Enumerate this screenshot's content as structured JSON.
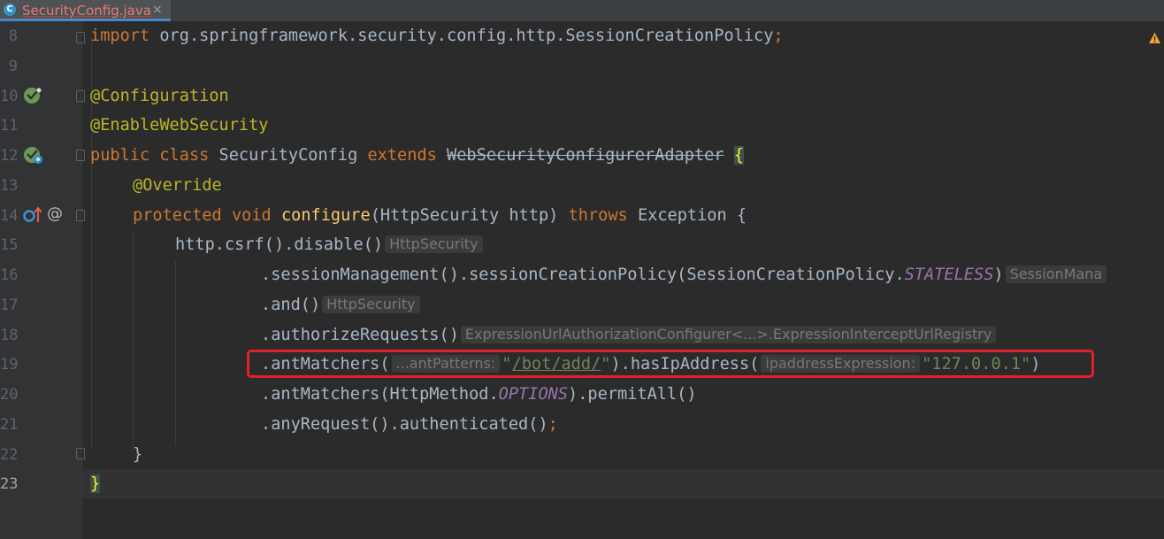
{
  "tab": {
    "icon": "C",
    "file_name": "SecurityConfig.java",
    "close": "×"
  },
  "gutter": {
    "warning_icon": "warning-icon",
    "bean_icon": "spring-bean-icon",
    "override_icon": "override-up-arrow-icon",
    "at_icon": "@"
  },
  "lines": [
    {
      "num": "8",
      "text": "import org.springframework.security.config.http.SessionCreationPolicy;"
    },
    {
      "num": "9",
      "text": ""
    },
    {
      "num": "10",
      "text": "@Configuration"
    },
    {
      "num": "11",
      "text": "@EnableWebSecurity"
    },
    {
      "num": "12",
      "text": "public class SecurityConfig extends WebSecurityConfigurerAdapter {"
    },
    {
      "num": "13",
      "text": "@Override"
    },
    {
      "num": "14",
      "text": "protected void configure(HttpSecurity http) throws Exception {"
    },
    {
      "num": "15",
      "text": "http.csrf().disable()"
    },
    {
      "num": "16",
      "text": ".sessionManagement().sessionCreationPolicy(SessionCreationPolicy.STATELESS)"
    },
    {
      "num": "17",
      "text": ".and()"
    },
    {
      "num": "18",
      "text": ".authorizeRequests()"
    },
    {
      "num": "19",
      "text": ".antMatchers(\"/bot/add/\").hasIpAddress(\"127.0.0.1\")"
    },
    {
      "num": "20",
      "text": ".antMatchers(HttpMethod.OPTIONS).permitAll()"
    },
    {
      "num": "21",
      "text": ".anyRequest().authenticated();"
    },
    {
      "num": "22",
      "text": "}"
    },
    {
      "num": "23",
      "text": "}"
    }
  ],
  "tokens": {
    "import_kw": "import",
    "import_path": " org.springframework.security.config.http.SessionCreationPolicy",
    "semicolon": ";",
    "ann_configuration": "@Configuration",
    "ann_enablewebsecurity": "@EnableWebSecurity",
    "public_class": "public class",
    "class_name": " SecurityConfig ",
    "extends_kw": "extends",
    "space": " ",
    "parent_class": "WebSecurityConfigurerAdapter",
    "open_brace": "{",
    "close_brace": "}",
    "ann_override": "@Override",
    "protected_void": "protected void",
    "configure_method": "configure",
    "params": "(HttpSecurity http) ",
    "throws_kw": "throws",
    "exception_open": " Exception {",
    "csrf_chain": "http.csrf().disable()",
    "session_mgmt": ".sessionManagement().sessionCreationPolicy(SessionCreationPolicy.",
    "stateless": "STATELESS",
    "close_paren": ")",
    "and_call": ".and()",
    "authorize_requests": ".authorizeRequests()",
    "ant_matchers_open": ".antMatchers(",
    "quote": "\"",
    "bot_add_path": "/bot/add/",
    "has_ip_open": ").hasIpAddress(",
    "ip_string": "\"127.0.0.1\"",
    "ant_matchers_options_open": ".antMatchers(HttpMethod.",
    "options": "OPTIONS",
    "permit_all": ").permitAll()",
    "any_request": ".anyRequest().authenticated()"
  },
  "hints": {
    "line15": "HttpSecurity",
    "line16": "SessionMana",
    "line17": "HttpSecurity",
    "line18": "ExpressionUrlAuthorizationConfigurer<...>.ExpressionInterceptUrlRegistry",
    "line19_ant": "...antPatterns:",
    "line19_ip": "ipaddressExpression:"
  },
  "colors": {
    "background": "#2b2b2b",
    "keyword": "#cc7832",
    "annotation": "#bbb529",
    "method": "#ffc66d",
    "string": "#6a8759",
    "constant": "#9876aa",
    "highlight_box": "#e0202a"
  }
}
